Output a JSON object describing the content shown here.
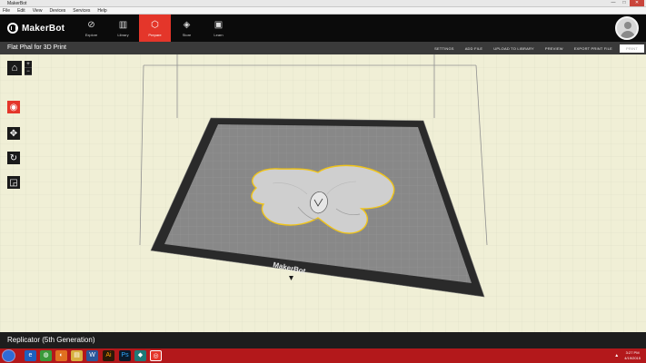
{
  "window": {
    "title": "MakerBot",
    "controls": [
      "—",
      "□",
      "✕"
    ]
  },
  "menubar": [
    "File",
    "Edit",
    "View",
    "Devices",
    "Services",
    "Help"
  ],
  "nav": {
    "logo_text": "MakerBot",
    "tabs": [
      {
        "label": "Explore",
        "icon": "compass-icon",
        "active": false
      },
      {
        "label": "Library",
        "icon": "library-icon",
        "active": false
      },
      {
        "label": "Prepare",
        "icon": "prepare-icon",
        "active": true
      },
      {
        "label": "Store",
        "icon": "cube-icon",
        "active": false
      },
      {
        "label": "Learn",
        "icon": "learn-icon",
        "active": false
      }
    ]
  },
  "subbar": {
    "file_title": "Flat Phal for 3D Print",
    "actions": [
      "SETTINGS",
      "ADD FILE",
      "UPLOAD TO LIBRARY",
      "PREVIEW",
      "EXPORT PRINT FILE"
    ],
    "print_label": "PRINT"
  },
  "build_plate": {
    "brand": "MakerBot"
  },
  "printer": {
    "name": "Replicator (5th Generation)"
  },
  "taskbar": {
    "apps": [
      "ie-icon",
      "chrome-icon",
      "firefox-icon",
      "explorer-icon",
      "word-icon",
      "illustrator-icon",
      "photoshop-icon",
      "app-icon",
      "makerbot-icon"
    ],
    "clock_time": "3:27 PM",
    "clock_date": "4/19/2015"
  },
  "colors": {
    "accent": "#e4362a",
    "taskbar": "#b3181b",
    "plate": "#898989",
    "model": "#cfcfcf",
    "model_outline": "#f0c419"
  }
}
